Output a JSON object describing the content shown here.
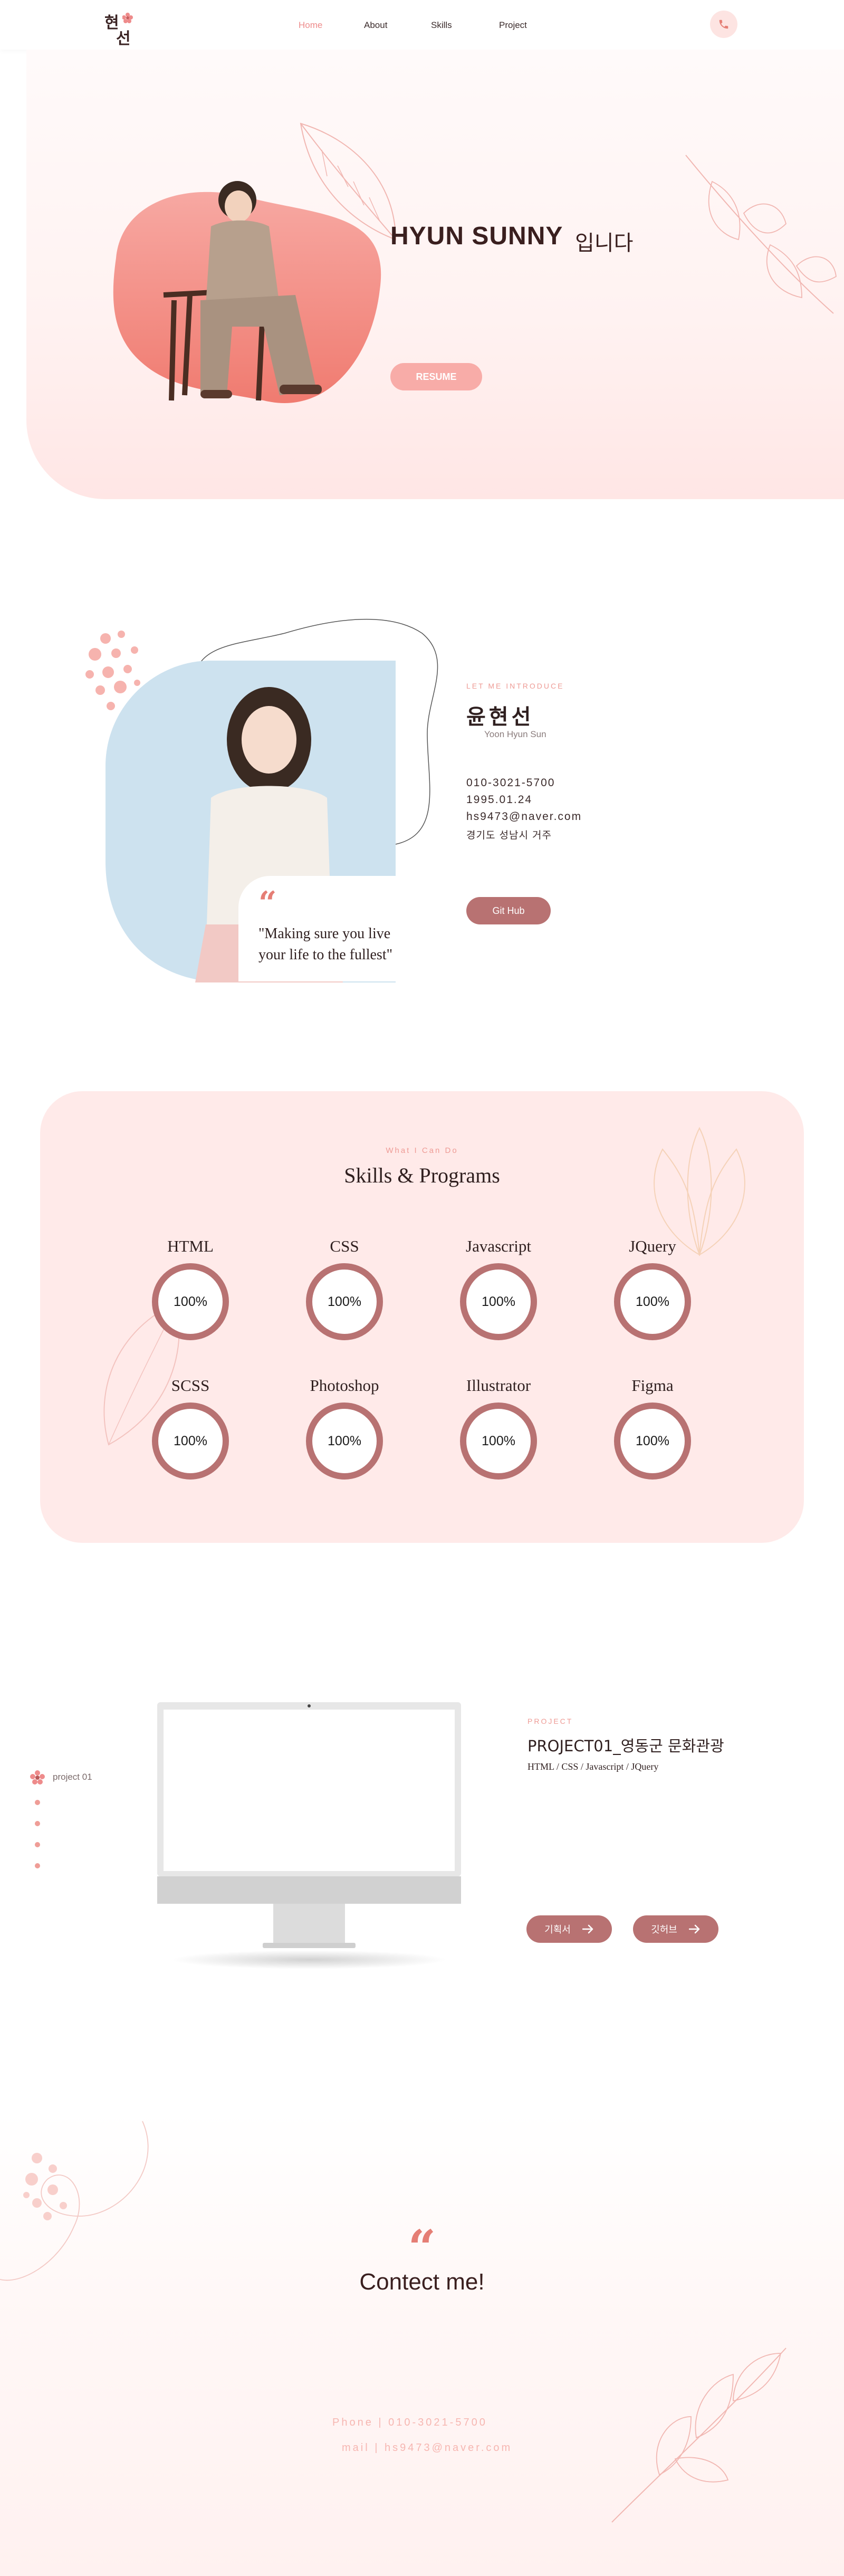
{
  "nav": {
    "logo_line1": "현",
    "logo_line2": "선",
    "links": [
      "Home",
      "About",
      "Skills",
      "Project"
    ],
    "active_link": "Home",
    "phone_icon": "phone-icon"
  },
  "hero": {
    "name": "HYUN SUNNY",
    "suffix": "입니다",
    "resume_label": "RESUME"
  },
  "about": {
    "tag": "LET ME INTRODUCE",
    "name": "윤현선",
    "roman": "Yoon Hyun Sun",
    "phone": "010-3021-5700",
    "birth": "1995.01.24",
    "email": "hs9473@naver.com",
    "location": "경기도 성남시 거주",
    "github_label": "Git Hub",
    "quote_line1": "\"Making sure you live",
    "quote_line2": "your life to the fullest\""
  },
  "skills": {
    "tag": "What I Can Do",
    "title": "Skills & Programs",
    "items": [
      {
        "name": "HTML",
        "value": "100%"
      },
      {
        "name": "CSS",
        "value": "100%"
      },
      {
        "name": "Javascript",
        "value": "100%"
      },
      {
        "name": "JQuery",
        "value": "100%"
      },
      {
        "name": "SCSS",
        "value": "100%"
      },
      {
        "name": "Photoshop",
        "value": "100%"
      },
      {
        "name": "Illustrator",
        "value": "100%"
      },
      {
        "name": "Figma",
        "value": "100%"
      }
    ]
  },
  "project": {
    "nav_label": "project 01",
    "tag": "PROJECT",
    "title": "PROJECT01_영동군 문화관광",
    "stack": "HTML / CSS / Javascript / JQuery",
    "plan_label": "기획서",
    "view_label": "깃허브"
  },
  "contact": {
    "title": "Contect me!",
    "phone": "Phone | 010-3021-5700",
    "mail": "mail | hs9473@naver.com"
  },
  "colors": {
    "accent": "#b87272",
    "pink": "#ee8b8b",
    "light_pink": "#ffeae9"
  }
}
